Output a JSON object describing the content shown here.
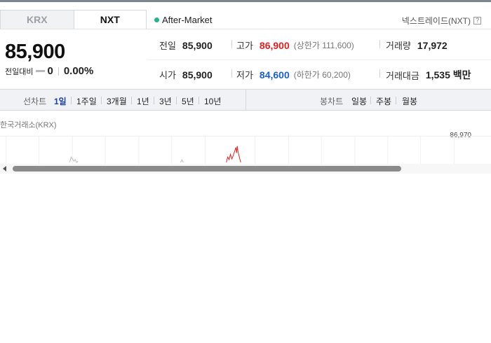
{
  "tabs": [
    {
      "label": "KRX",
      "active": false
    },
    {
      "label": "NXT",
      "active": true
    }
  ],
  "market_status": "After-Market",
  "provider": "넥스트레이드(NXT)",
  "help_glyph": "?",
  "quote": {
    "price": "85,900",
    "change_label": "전일대비",
    "change_value": "0",
    "change_rate": "0.00%"
  },
  "stats": {
    "prev_close": {
      "label": "전일",
      "value": "85,900"
    },
    "high": {
      "label": "고가",
      "value": "86,900",
      "sub": "(상한가 111,600)"
    },
    "volume": {
      "label": "거래량",
      "value": "17,972"
    },
    "open": {
      "label": "시가",
      "value": "85,900"
    },
    "low": {
      "label": "저가",
      "value": "84,600",
      "sub": "(하한가 60,200)"
    },
    "turnover": {
      "label": "거래대금",
      "value": "1,535 백만"
    }
  },
  "line_chart": {
    "label": "선차트",
    "periods": [
      "1일",
      "1주일",
      "3개월",
      "1년",
      "3년",
      "5년",
      "10년"
    ],
    "active": "1일"
  },
  "candle_chart": {
    "label": "봉차트",
    "periods": [
      "일봉",
      "주봉",
      "월봉"
    ]
  },
  "chart": {
    "source_label": "한국거래소(KRX)",
    "top_tick": "86,970"
  },
  "colors": {
    "up": "#e02020",
    "down": "#1a5fcc",
    "status": "#23b58c",
    "active_period": "#1a3fa8"
  }
}
